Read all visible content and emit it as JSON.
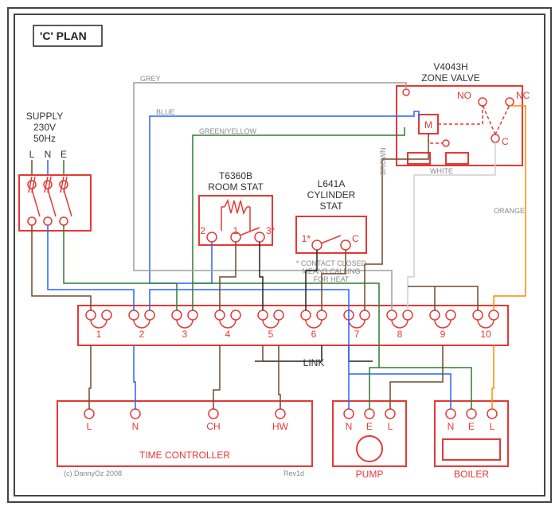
{
  "title_box": "'C' PLAN",
  "supply": {
    "heading1": "SUPPLY",
    "heading2": "230V",
    "heading3": "50Hz",
    "L": "L",
    "N": "N",
    "E": "E"
  },
  "zone_valve": {
    "heading1": "V4043H",
    "heading2": "ZONE VALVE",
    "M": "M",
    "NO": "NO",
    "NC": "NC",
    "C": "C"
  },
  "room_stat": {
    "heading1": "T6360B",
    "heading2": "ROOM STAT",
    "t1": "1",
    "t2": "2",
    "t3": "3*"
  },
  "cyl_stat": {
    "heading1": "L641A",
    "heading2": "CYLINDER",
    "heading3": "STAT",
    "t1": "1*",
    "tC": "C",
    "note1": "* CONTACT CLOSED",
    "note2": "MEANS CALLING",
    "note3": "FOR HEAT"
  },
  "junction": {
    "t1": "1",
    "t2": "2",
    "t3": "3",
    "t4": "4",
    "t5": "5",
    "t6": "6",
    "t7": "7",
    "t8": "8",
    "t9": "9",
    "t10": "10",
    "link": "LINK"
  },
  "time_ctrl": {
    "L": "L",
    "N": "N",
    "CH": "CH",
    "HW": "HW",
    "title": "TIME CONTROLLER"
  },
  "pump": {
    "N": "N",
    "E": "E",
    "L": "L",
    "title": "PUMP"
  },
  "boiler": {
    "N": "N",
    "E": "E",
    "L": "L",
    "title": "BOILER"
  },
  "wire_labels": {
    "grey": "GREY",
    "blue": "BLUE",
    "greenyellow": "GREEN/YELLOW",
    "brown": "BROWN",
    "white": "WHITE",
    "orange": "ORANGE"
  },
  "credits": {
    "left": "(c) DannyOz 2008",
    "right": "Rev1d"
  }
}
